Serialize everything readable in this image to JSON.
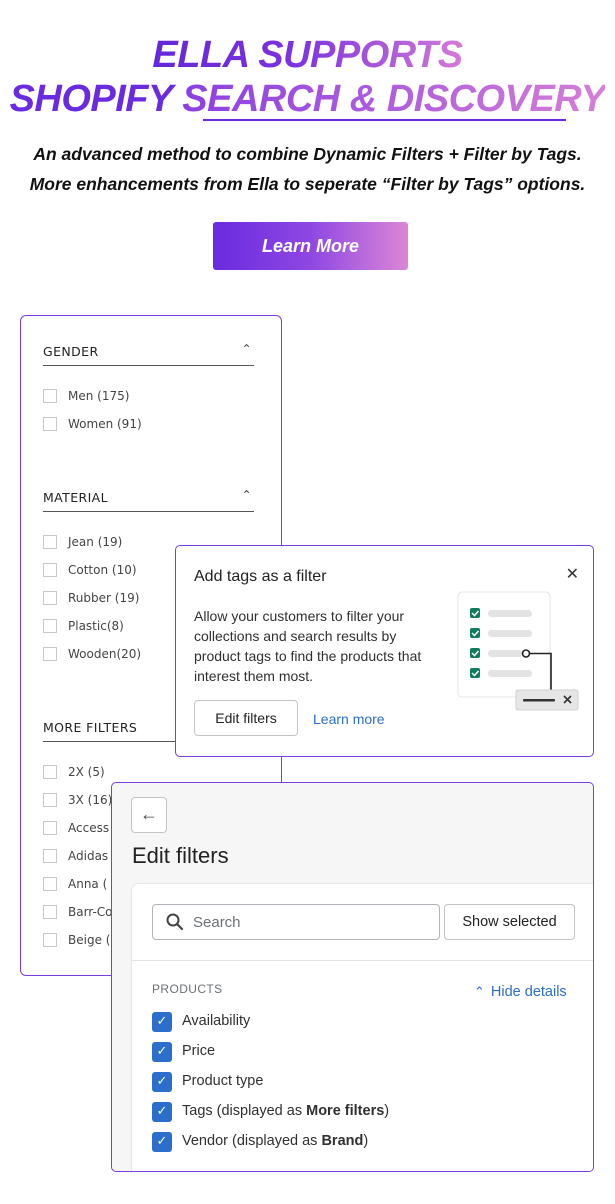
{
  "hero": {
    "line1": "ELLA SUPPORTS",
    "line2_a": "SHOPIFY ",
    "line2_b": "SEARCH & DISCOVERY",
    "subtitle1": "An advanced method to combine Dynamic Filters + Filter by Tags.",
    "subtitle2": "More enhancements from Ella to seperate “Filter by Tags” options.",
    "cta_label": "Learn More"
  },
  "store_filters": {
    "sections": [
      {
        "title": "GENDER",
        "options": [
          "Men (175)",
          "Women (91)"
        ]
      },
      {
        "title": "MATERIAL",
        "options": [
          "Jean (19)",
          "Cotton (10)",
          "Rubber (19)",
          "Plastic(8)",
          "Wooden(20)"
        ]
      },
      {
        "title": "MORE FILTERS",
        "options": [
          "2X (5)",
          "3X (16)",
          "Access",
          "Adidas",
          "Anna (",
          "Barr-Co",
          "Beige ("
        ]
      }
    ]
  },
  "tag_popup": {
    "title": "Add tags as a filter",
    "description": "Allow your customers to filter your collections and search results by product tags to find the products that interest them most.",
    "edit_button": "Edit filters",
    "learn_link": "Learn more"
  },
  "edit_filters": {
    "title": "Edit filters",
    "search_placeholder": "Search",
    "show_selected": "Show selected",
    "section_label": "PRODUCTS",
    "hide_details": "Hide details",
    "items": [
      {
        "text": "Availability",
        "bold": ""
      },
      {
        "text": "Price",
        "bold": ""
      },
      {
        "text": "Product type",
        "bold": ""
      },
      {
        "text": "Tags (displayed as ",
        "bold": "More filters",
        "tail": ")"
      },
      {
        "text": "Vendor (displayed as ",
        "bold": "Brand",
        "tail": ")"
      }
    ]
  },
  "colors": {
    "brand_purple": "#6a2be0",
    "brand_pink": "#db86d6",
    "shopify_blue": "#2c6ecb",
    "check_green": "#0f7b5f"
  }
}
